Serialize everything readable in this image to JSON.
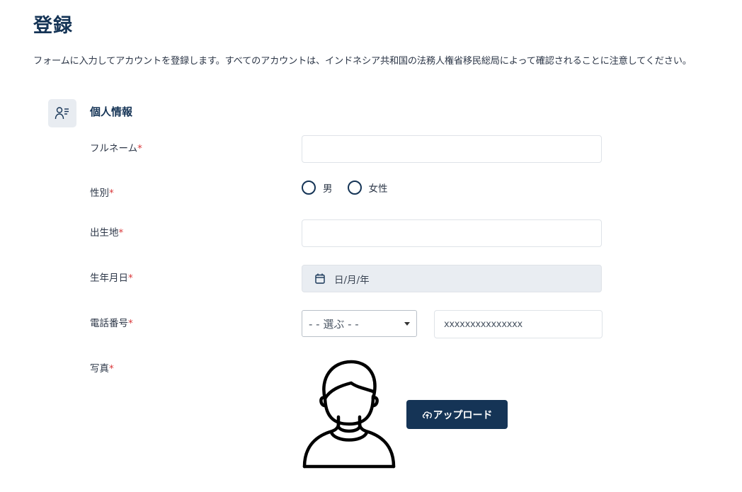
{
  "page": {
    "title": "登録",
    "description": "フォームに入力してアカウントを登録します。すべてのアカウントは、インドネシア共和国の法務人権省移民総局によって確認されることに注意してください。"
  },
  "section": {
    "title": "個人情報",
    "icon": "user-list-icon"
  },
  "form": {
    "required_mark": "*",
    "full_name": {
      "label": "フルネーム",
      "value": ""
    },
    "gender": {
      "label": "性別",
      "options": [
        "男",
        "女性"
      ]
    },
    "birthplace": {
      "label": "出生地",
      "value": ""
    },
    "birthdate": {
      "label": "生年月日",
      "placeholder": "日/月/年",
      "icon": "calendar-icon"
    },
    "phone": {
      "label": "電話番号",
      "select_value": "- - 選ぶ - -",
      "placeholder": "xxxxxxxxxxxxxxx"
    },
    "photo": {
      "label": "写真",
      "upload_label": "アップロード",
      "upload_icon": "cloud-upload-icon"
    }
  },
  "colors": {
    "brand": "#153456",
    "required": "#d9383a",
    "disabled_bg": "#e9edf2"
  }
}
